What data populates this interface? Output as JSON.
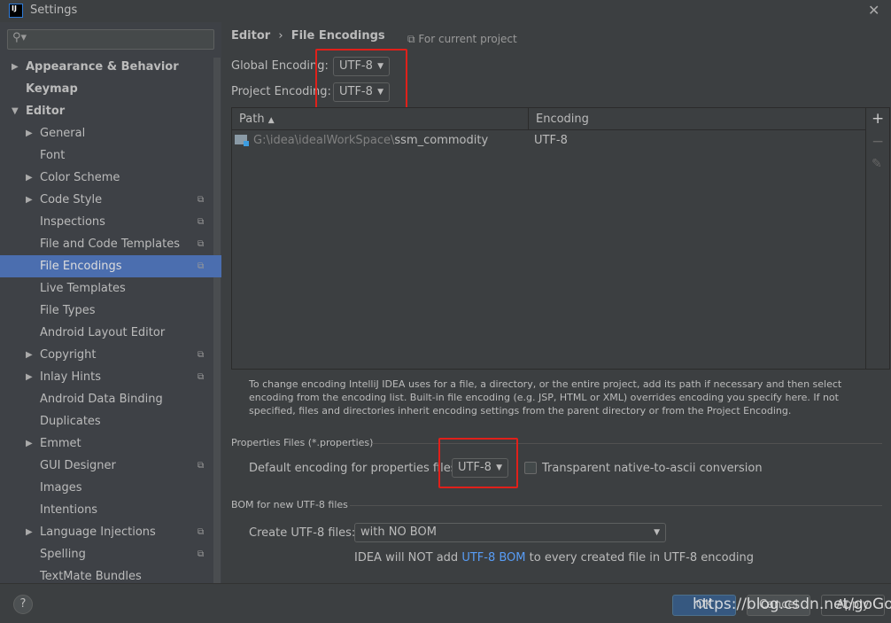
{
  "window": {
    "title": "Settings",
    "logo": "IJ",
    "close_icon": "close-icon"
  },
  "search": {
    "placeholder": "",
    "icon": "search-icon"
  },
  "sidebar": {
    "items": [
      {
        "label": "Appearance & Behavior",
        "arrow": "▶",
        "bold": true,
        "level": 0
      },
      {
        "label": "Keymap",
        "arrow": "",
        "bold": true,
        "level": 0
      },
      {
        "label": "Editor",
        "arrow": "▼",
        "bold": true,
        "level": 0
      },
      {
        "label": "General",
        "arrow": "▶",
        "level": 1
      },
      {
        "label": "Font",
        "arrow": "",
        "level": 1
      },
      {
        "label": "Color Scheme",
        "arrow": "▶",
        "level": 1
      },
      {
        "label": "Code Style",
        "arrow": "▶",
        "level": 1,
        "copy": true
      },
      {
        "label": "Inspections",
        "arrow": "",
        "level": 1,
        "copy": true
      },
      {
        "label": "File and Code Templates",
        "arrow": "",
        "level": 1,
        "copy": true
      },
      {
        "label": "File Encodings",
        "arrow": "",
        "level": 1,
        "copy": true,
        "selected": true
      },
      {
        "label": "Live Templates",
        "arrow": "",
        "level": 1
      },
      {
        "label": "File Types",
        "arrow": "",
        "level": 1
      },
      {
        "label": "Android Layout Editor",
        "arrow": "",
        "level": 1
      },
      {
        "label": "Copyright",
        "arrow": "▶",
        "level": 1,
        "copy": true
      },
      {
        "label": "Inlay Hints",
        "arrow": "▶",
        "level": 1,
        "copy": true
      },
      {
        "label": "Android Data Binding",
        "arrow": "",
        "level": 1
      },
      {
        "label": "Duplicates",
        "arrow": "",
        "level": 1
      },
      {
        "label": "Emmet",
        "arrow": "▶",
        "level": 1
      },
      {
        "label": "GUI Designer",
        "arrow": "",
        "level": 1,
        "copy": true
      },
      {
        "label": "Images",
        "arrow": "",
        "level": 1
      },
      {
        "label": "Intentions",
        "arrow": "",
        "level": 1
      },
      {
        "label": "Language Injections",
        "arrow": "▶",
        "level": 1,
        "copy": true
      },
      {
        "label": "Spelling",
        "arrow": "",
        "level": 1,
        "copy": true
      },
      {
        "label": "TextMate Bundles",
        "arrow": "",
        "level": 1
      }
    ]
  },
  "breadcrumb": {
    "parent": "Editor",
    "sep": "›",
    "current": "File Encodings",
    "for_project": "For current project"
  },
  "global_encoding": {
    "label": "Global Encoding:",
    "value": "UTF-8"
  },
  "project_encoding": {
    "label": "Project Encoding:",
    "value": "UTF-8"
  },
  "table": {
    "columns": [
      "Path",
      "Encoding"
    ],
    "sort": "▲",
    "rows": [
      {
        "path_prefix": "G:\\idea\\idealWorkSpace\\",
        "path_name": "ssm_commodity",
        "encoding": "UTF-8"
      }
    ],
    "tools": [
      "+",
      "−",
      "✎"
    ]
  },
  "hint": "To change encoding IntelliJ IDEA uses for a file, a directory, or the entire project, add its path if necessary and then select encoding from the encoding list. Built-in file encoding (e.g. JSP, HTML or XML) overrides encoding you specify here. If not specified, files and directories inherit encoding settings from the parent directory or from the Project Encoding.",
  "properties": {
    "section": "Properties Files (*.properties)",
    "label": "Default encoding for properties files:",
    "value": "UTF-8",
    "checkbox_label": "Transparent native-to-ascii conversion",
    "checked": false
  },
  "bom": {
    "section": "BOM for new UTF-8 files",
    "label": "Create UTF-8 files:",
    "value": "with NO BOM",
    "note_pre": "IDEA will NOT add ",
    "note_link": "UTF-8 BOM",
    "note_post": " to every created file in UTF-8 encoding"
  },
  "footer": {
    "help": "?",
    "ok": "OK",
    "cancel": "Cancel",
    "apply": "Apply"
  },
  "watermark": "https://blog.csdn.net/goGoing_",
  "colors": {
    "selection": "#4b6eaf",
    "highlight": "#e0201a",
    "link": "#589df6"
  }
}
